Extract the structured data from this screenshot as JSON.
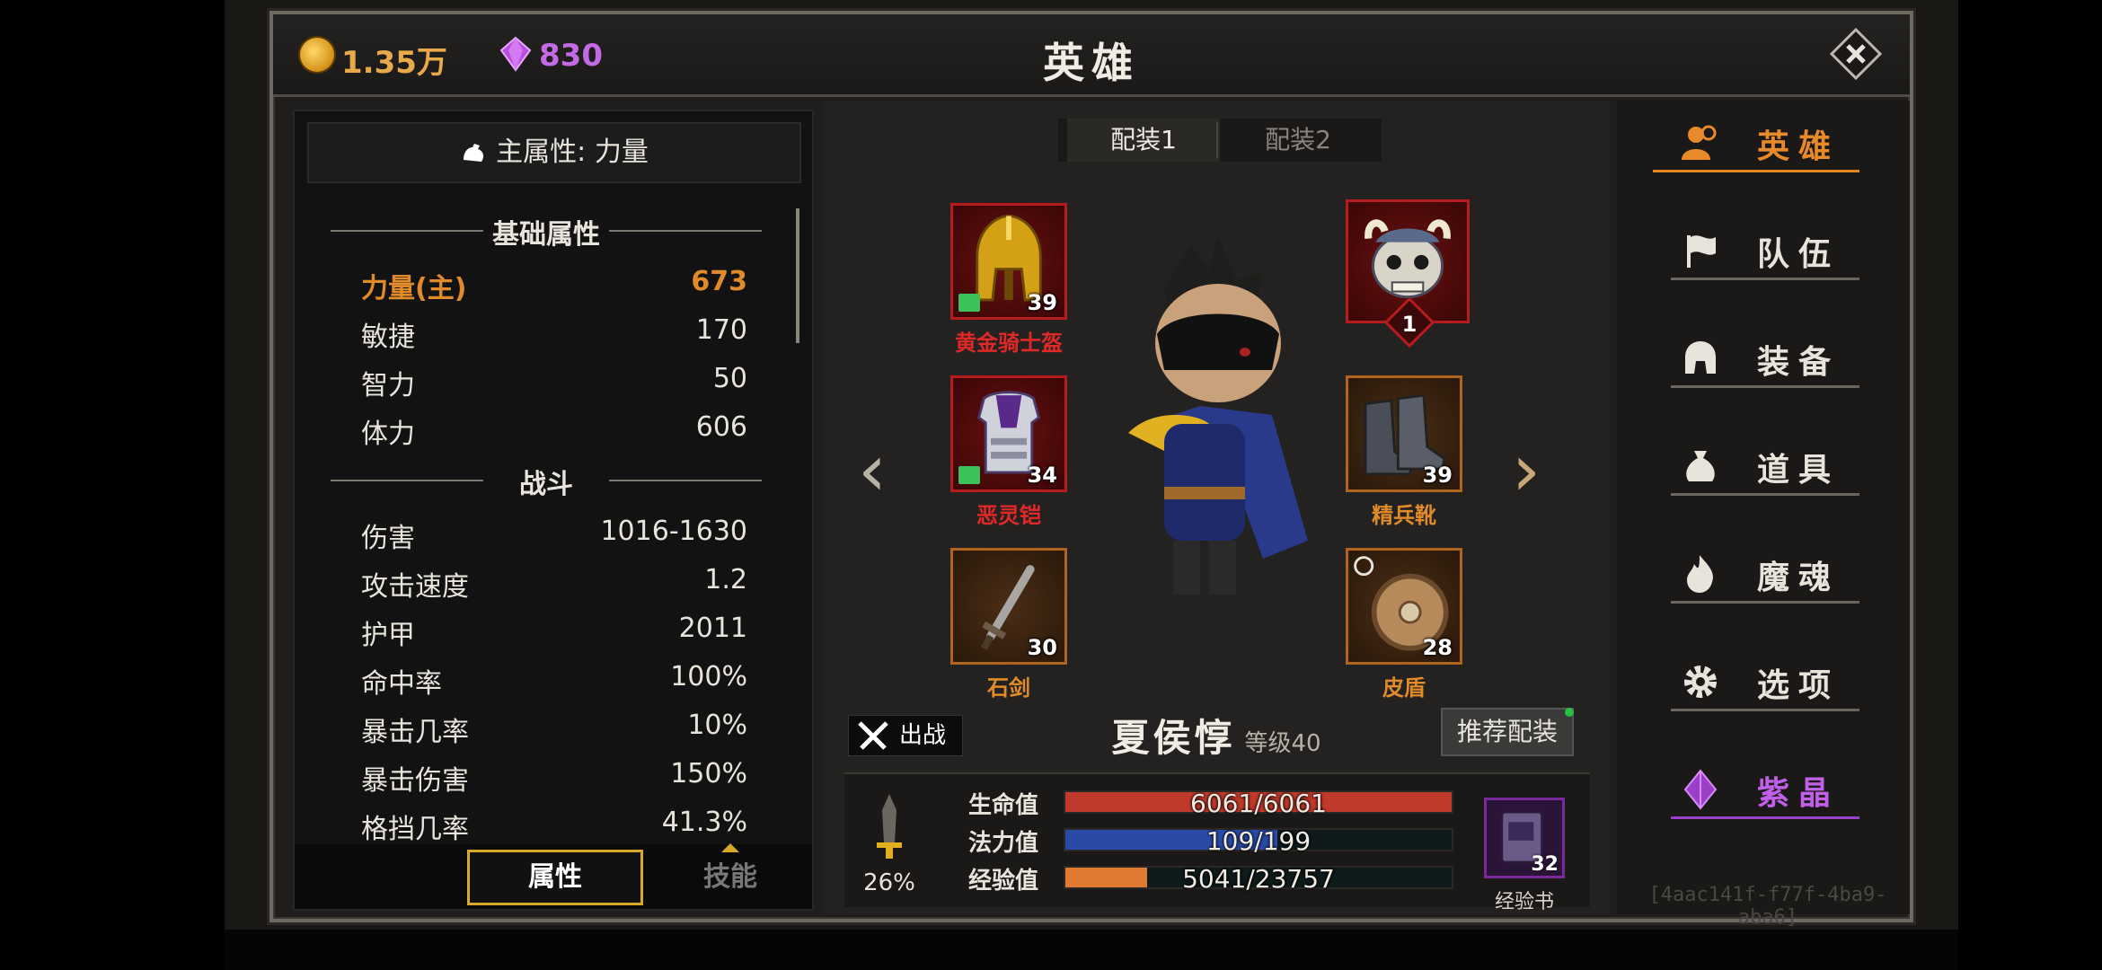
{
  "currency": {
    "gold": "1.35万",
    "gem": "830"
  },
  "header": {
    "title": "英雄"
  },
  "left_panel": {
    "main_attr": "主属性: 力量",
    "basic_section": "基础属性",
    "combat_section": "战斗",
    "basic_stats": [
      {
        "label": "力量(主)",
        "value": "673"
      },
      {
        "label": "敏捷",
        "value": "170"
      },
      {
        "label": "智力",
        "value": "50"
      },
      {
        "label": "体力",
        "value": "606"
      }
    ],
    "combat_stats": [
      {
        "label": "伤害",
        "value": "1016-1630"
      },
      {
        "label": "攻击速度",
        "value": "1.2"
      },
      {
        "label": "护甲",
        "value": "2011"
      },
      {
        "label": "命中率",
        "value": "100%"
      },
      {
        "label": "暴击几率",
        "value": "10%"
      },
      {
        "label": "暴击伤害",
        "value": "150%"
      },
      {
        "label": "格挡几率",
        "value": "41.3%"
      }
    ],
    "tabs": {
      "attributes": "属性",
      "skills": "技能"
    }
  },
  "loadout": {
    "tab1": "配装1",
    "tab2": "配装2"
  },
  "equipment": {
    "helmet": {
      "name": "黄金骑士盔",
      "level": "39"
    },
    "armor": {
      "name": "恶灵铠",
      "level": "34"
    },
    "weapon": {
      "name": "石剑",
      "level": "30"
    },
    "pet": {
      "level": "1"
    },
    "boots": {
      "name": "精兵靴",
      "level": "39"
    },
    "shield": {
      "name": "皮盾",
      "level": "28"
    }
  },
  "hero": {
    "deploy_label": "出战",
    "name": "夏侯惇",
    "level_label": "等级40",
    "recommend_label": "推荐配装",
    "weapon_pct": "26%",
    "hp_label": "生命值",
    "hp": "6061/6061",
    "hp_frac": 1.0,
    "mp_label": "法力值",
    "mp": "109/199",
    "mp_frac": 0.548,
    "exp_label": "经验值",
    "exp": "5041/23757",
    "exp_frac": 0.212,
    "expbook_count": "32",
    "expbook_label": "经验书"
  },
  "menu": [
    {
      "label": "英雄",
      "icon": "hero-icon"
    },
    {
      "label": "队伍",
      "icon": "flag-icon"
    },
    {
      "label": "装备",
      "icon": "helmet-icon"
    },
    {
      "label": "道具",
      "icon": "bag-icon"
    },
    {
      "label": "魔魂",
      "icon": "flame-icon"
    },
    {
      "label": "选项",
      "icon": "gear-icon"
    },
    {
      "label": "紫晶",
      "icon": "crystal-icon"
    }
  ],
  "uid": "[4aac141f-f77f-4ba9-aba6]",
  "colors": {
    "accent": "#e88a2a",
    "red_rarity": "#b51c20",
    "orange_rarity": "#b0651e",
    "hp": "#c0392b",
    "mp": "#2a4aa8",
    "exp": "#e07a30",
    "purple": "#c060e8"
  }
}
